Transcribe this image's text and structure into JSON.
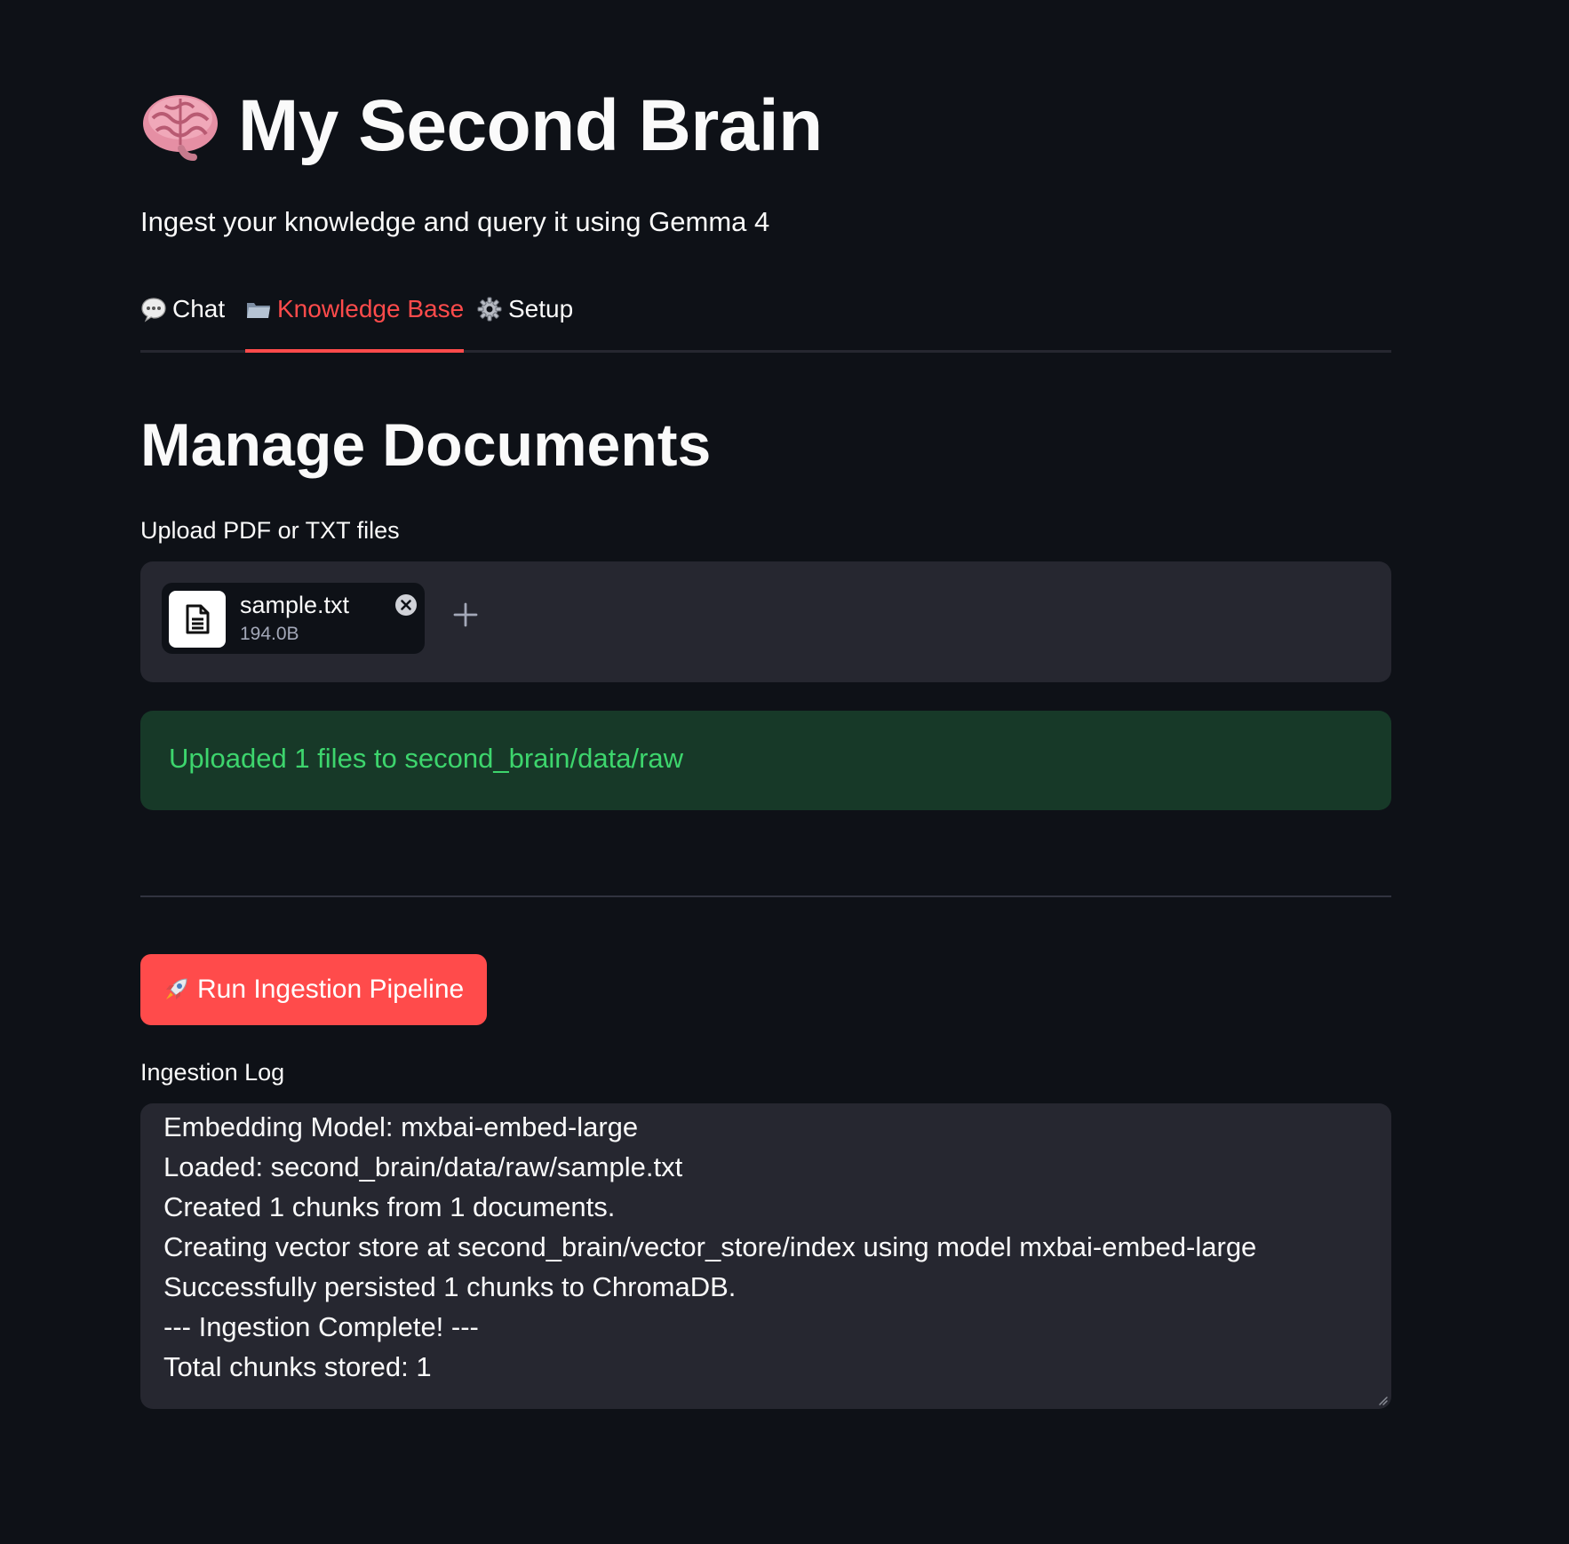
{
  "header": {
    "title": "My Second Brain",
    "subtitle": "Ingest your knowledge and query it using Gemma 4",
    "icon": "brain-icon"
  },
  "tabs": [
    {
      "label": "Chat",
      "icon": "speech-bubble-icon",
      "active": false
    },
    {
      "label": "Knowledge Base",
      "icon": "folder-icon",
      "active": true
    },
    {
      "label": "Setup",
      "icon": "gear-icon",
      "active": false
    }
  ],
  "main": {
    "section_title": "Manage Documents",
    "upload_label": "Upload PDF or TXT files",
    "uploaded_file": {
      "name": "sample.txt",
      "size": "194.0B",
      "icon": "document-icon"
    },
    "success_message": "Uploaded 1 files to second_brain/data/raw",
    "run_button_label": "Run Ingestion Pipeline",
    "run_button_icon": "rocket-icon",
    "log_label": "Ingestion Log",
    "log_lines": [
      "Embedding Model: mxbai-embed-large",
      "Loaded: second_brain/data/raw/sample.txt",
      "Created 1 chunks from 1 documents.",
      "Creating vector store at second_brain/vector_store/index using model mxbai-embed-large",
      "Successfully persisted 1 chunks to ChromaDB.",
      "--- Ingestion Complete! ---",
      "Total chunks stored: 1"
    ]
  },
  "colors": {
    "background": "#0e1117",
    "panel": "#262730",
    "accent": "#ff4b4b",
    "success_bg": "#173928",
    "success_text": "#3dd56d",
    "text": "#fafafa"
  }
}
